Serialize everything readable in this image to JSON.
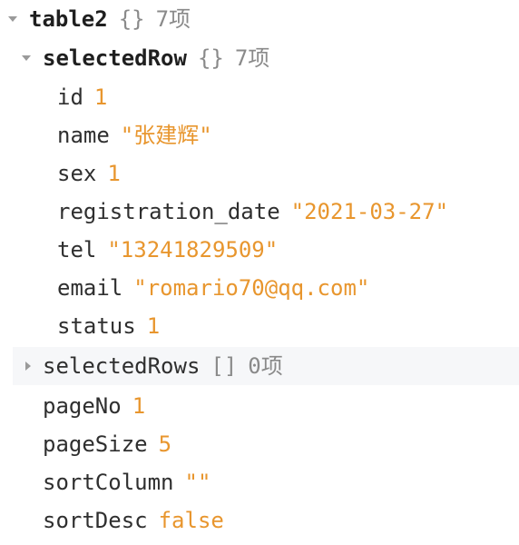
{
  "root": {
    "key": "table2",
    "brace": "{}",
    "count": "7项",
    "children": {
      "selectedRow": {
        "key": "selectedRow",
        "brace": "{}",
        "count": "7项",
        "fields": [
          {
            "key": "id",
            "value": "1",
            "type": "num"
          },
          {
            "key": "name",
            "value": "\"张建辉\"",
            "type": "str"
          },
          {
            "key": "sex",
            "value": "1",
            "type": "num"
          },
          {
            "key": "registration_date",
            "value": "\"2021-03-27\"",
            "type": "str"
          },
          {
            "key": "tel",
            "value": "\"13241829509\"",
            "type": "str"
          },
          {
            "key": "email",
            "value": "\"romario70@qq.com\"",
            "type": "str"
          },
          {
            "key": "status",
            "value": "1",
            "type": "num"
          }
        ]
      },
      "selectedRows": {
        "key": "selectedRows",
        "brace": "[]",
        "count": "0项"
      },
      "pageNo": {
        "key": "pageNo",
        "value": "1"
      },
      "pageSize": {
        "key": "pageSize",
        "value": "5"
      },
      "sortColumn": {
        "key": "sortColumn",
        "value": "\"\""
      },
      "sortDesc": {
        "key": "sortDesc",
        "value": "false"
      }
    }
  }
}
